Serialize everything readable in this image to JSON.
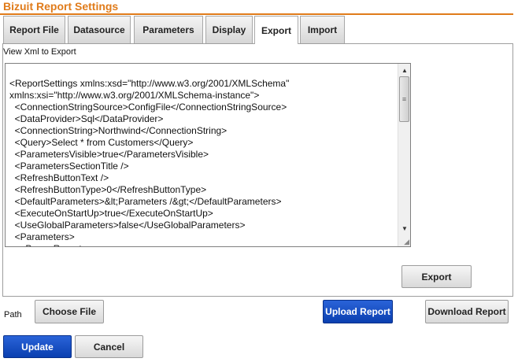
{
  "app": {
    "title": "Bizuit Report Settings"
  },
  "tabs": [
    {
      "label": "Report File"
    },
    {
      "label": "Datasource"
    },
    {
      "label": "Parameters"
    },
    {
      "label": "Display"
    },
    {
      "label": "Export",
      "active": true
    },
    {
      "label": "Import"
    }
  ],
  "export_panel": {
    "label": "View Xml to Export",
    "xml_lines": "<ReportSettings xmlns:xsd=\"http://www.w3.org/2001/XMLSchema\"\nxmlns:xsi=\"http://www.w3.org/2001/XMLSchema-instance\">\n  <ConnectionStringSource>ConfigFile</ConnectionStringSource>\n  <DataProvider>Sql</DataProvider>\n  <ConnectionString>Northwind</ConnectionString>\n  <Query>Select * from Customers</Query>\n  <ParametersVisible>true</ParametersVisible>\n  <ParametersSectionTitle />\n  <RefreshButtonText />\n  <RefreshButtonType>0</RefreshButtonType>\n  <DefaultParameters>&lt;Parameters /&gt;</DefaultParameters>\n  <ExecuteOnStartUp>true</ExecuteOnStartUp>\n  <UseGlobalParameters>false</UseGlobalParameters>\n  <Parameters>\n    <ParamReport>",
    "export_button": "Export"
  },
  "file_row": {
    "path_label": "Path",
    "choose_file_button": "Choose File",
    "upload_button": "Upload Report",
    "download_button": "Download Report"
  },
  "footer": {
    "update_button": "Update",
    "cancel_button": "Cancel"
  },
  "colors": {
    "accent": "#e07b1a",
    "primary_button": "#1046c0"
  }
}
